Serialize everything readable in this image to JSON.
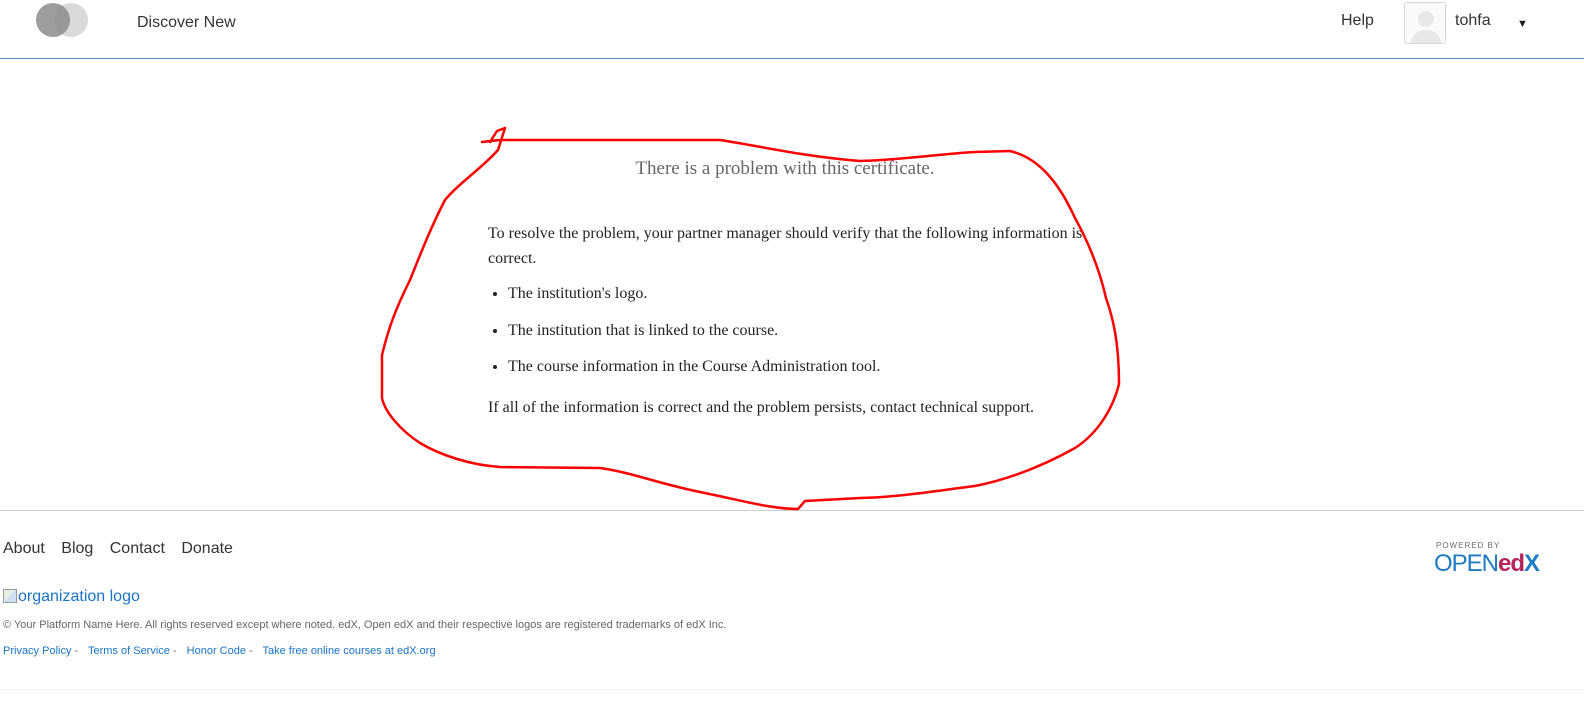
{
  "header": {
    "nav_discover": "Discover New",
    "help": "Help",
    "username": "tohfa",
    "caret_icon": "caret-down-icon"
  },
  "certificate_error": {
    "title": "There is a problem with this certificate.",
    "intro": "To resolve the problem, your partner manager should verify that the following information is correct.",
    "items": [
      "The institution's logo.",
      "The institution that is linked to the course.",
      "The course information in the Course Administration tool."
    ],
    "closing": "If all of the information is correct and the problem persists, contact technical support."
  },
  "footer": {
    "nav": [
      "About",
      "Blog",
      "Contact",
      "Donate"
    ],
    "org_logo_alt": "organization logo",
    "copyright": "© Your Platform Name Here. All rights reserved except where noted. edX, Open edX and their respective logos are registered trademarks of edX Inc.",
    "legal_links": [
      "Privacy Policy",
      "Terms of Service",
      "Honor Code",
      "Take free online courses at edX.org"
    ],
    "powered_by": "POWERED BY",
    "brand_open": "OPEN",
    "brand_ed": "ed",
    "brand_x": "X"
  },
  "colors": {
    "link": "#1a73c7",
    "annotation": "#ff0000",
    "header_border": "#5b8cc4"
  }
}
